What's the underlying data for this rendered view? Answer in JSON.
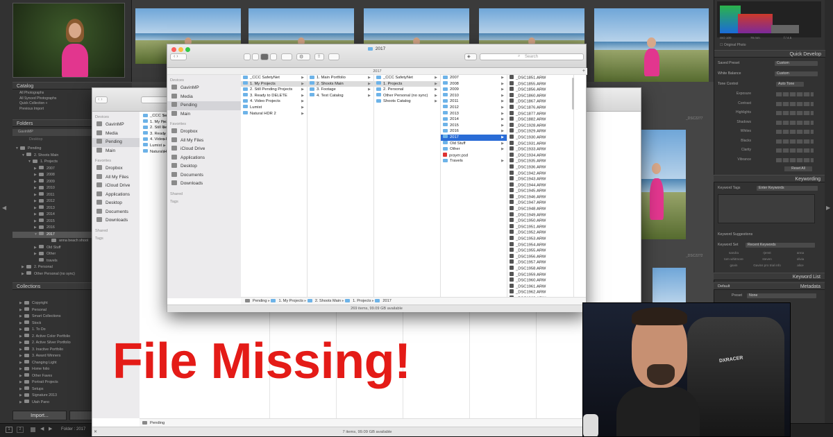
{
  "overlay_title": "File Missing!",
  "lightroom": {
    "catalog": {
      "header": "Catalog",
      "items": [
        "All Photographs",
        "All Synced Photographs",
        "Quick Collection +",
        "Previous Import"
      ]
    },
    "folders": {
      "header": "Folders",
      "volume": "GavinMP",
      "desktop": "Desktop",
      "rows": [
        {
          "label": "Pending",
          "indent": 0,
          "tri": "▼"
        },
        {
          "label": "2. Shoots Main",
          "indent": 1,
          "tri": "▼"
        },
        {
          "label": "1. Projects",
          "indent": 2,
          "tri": "▼"
        },
        {
          "label": "2007",
          "indent": 3,
          "tri": "▶"
        },
        {
          "label": "2008",
          "indent": 3,
          "tri": "▶"
        },
        {
          "label": "2009",
          "indent": 3,
          "tri": "▶"
        },
        {
          "label": "2010",
          "indent": 3,
          "tri": "▶"
        },
        {
          "label": "2011",
          "indent": 3,
          "tri": "▶"
        },
        {
          "label": "2012",
          "indent": 3,
          "tri": "▶"
        },
        {
          "label": "2013",
          "indent": 3,
          "tri": "▶"
        },
        {
          "label": "2014",
          "indent": 3,
          "tri": "▶"
        },
        {
          "label": "2015",
          "indent": 3,
          "tri": "▶"
        },
        {
          "label": "2016",
          "indent": 3,
          "tri": "▶"
        },
        {
          "label": "2017",
          "indent": 3,
          "tri": "▼",
          "selected": true
        },
        {
          "label": "anna beach shoot",
          "indent": 5,
          "tri": ""
        },
        {
          "label": "Old Stuff",
          "indent": 3,
          "tri": "▶"
        },
        {
          "label": "Other",
          "indent": 3,
          "tri": "▶"
        },
        {
          "label": "travels",
          "indent": 3,
          "tri": ""
        },
        {
          "label": "2. Personal",
          "indent": 1,
          "tri": "▶"
        },
        {
          "label": "Other Personal (no sync)",
          "indent": 1,
          "tri": "▶"
        }
      ]
    },
    "collections": {
      "header": "Collections",
      "items": [
        "Copyright",
        "Personal",
        "Smart Collections",
        "Stock",
        "1. To Do",
        "2. Active Color Portfolio",
        "2. Active Silver Portfolio",
        "3. Inactive Portfolio",
        "3. Award Winners",
        "Changing Light",
        "Home folio",
        "Other Faves",
        "Portrait Projects",
        "Setups",
        "Signature 2013",
        "Utah Pano"
      ]
    },
    "import_button": "Import...",
    "folder_status": "Folder : 2017",
    "page_numbers": [
      "1",
      "2"
    ],
    "filenames": [
      "_DSC2277",
      "_DSC2272"
    ],
    "histogram": {
      "iso": "ISO 100",
      "lens": "78 mm",
      "aperture": "f / 4.5",
      "original": "Original Photo"
    },
    "quick_develop": {
      "header": "Quick Develop",
      "saved_preset": "Saved Preset",
      "saved_preset_value": "Custom",
      "white_balance": "White Balance",
      "white_balance_value": "Custom",
      "tone_control": "Tone Control",
      "auto_tone": "Auto Tone",
      "sliders": [
        "Exposure",
        "Contrast",
        "Highlights",
        "Shadows",
        "Whites",
        "Blacks",
        "Clarity",
        "Vibrance"
      ],
      "reset": "Reset All"
    },
    "keywording": {
      "header": "Keywording",
      "tags_label": "Keyword Tags",
      "tags_value": "Enter Keywords",
      "suggestions": "Keyword Suggestions",
      "set_label": "Keyword Set",
      "set_value": "Recent Keywords",
      "words": [
        "sandra",
        "rjenst",
        "anna",
        "tom whitmore",
        "steven",
        "olivia",
        "gavin",
        "Gavins pro trial info",
        "alice"
      ]
    },
    "keyword_list": "Keyword List",
    "metadata": {
      "header": "Metadata",
      "default": "Default",
      "preset": "Preset",
      "preset_value": "None"
    }
  },
  "finder_front": {
    "title": "2017",
    "path_header": "2017",
    "search_placeholder": "Search",
    "sidebar": {
      "devices_header": "Devices",
      "devices": [
        "GavinMP",
        "Media",
        "Pending",
        "Main"
      ],
      "favorites_header": "Favorites",
      "favorites": [
        "Dropbox",
        "All My Files",
        "iCloud Drive",
        "Applications",
        "Desktop",
        "Documents",
        "Downloads"
      ],
      "shared_header": "Shared",
      "tags_header": "Tags"
    },
    "col1": [
      "_CCC SafetyNet",
      "1. My Projects",
      "2. Still Pending Projects",
      "3. Ready to DELETE",
      "4. Video Projects",
      "Lumist",
      "Natural HDR 2"
    ],
    "col2": [
      "1. Main Portfolio",
      "2. Shoots Main",
      "3. Footage",
      "4. Test Catalog"
    ],
    "col3": [
      "_CCC SafetyNet",
      "1. Projects",
      "2. Personal",
      "Other Personal (no sync)",
      "Shoots Catalog"
    ],
    "col4": [
      "2007",
      "2008",
      "2009",
      "2010",
      "2011",
      "2012",
      "2013",
      "2014",
      "2015",
      "2016",
      "2017",
      "Old Stuff",
      "Other",
      "prayer.psd",
      "Travels"
    ],
    "col5": [
      "_DSC1851.ARW",
      "_DSC1855.ARW",
      "_DSC1856.ARW",
      "_DSC1860.ARW",
      "_DSC1867.ARW",
      "_DSC1876.ARW",
      "_DSC1877.ARW",
      "_DSC1882.ARW",
      "_DSC1928.ARW",
      "_DSC1929.ARW",
      "_DSC1930.ARW",
      "_DSC1931.ARW",
      "_DSC1933.ARW",
      "_DSC1934.ARW",
      "_DSC1935.ARW",
      "_DSC1936.ARW",
      "_DSC1942.ARW",
      "_DSC1943.ARW",
      "_DSC1944.ARW",
      "_DSC1945.ARW",
      "_DSC1946.ARW",
      "_DSC1947.ARW",
      "_DSC1948.ARW",
      "_DSC1949.ARW",
      "_DSC1950.ARW",
      "_DSC1951.ARW",
      "_DSC1952.ARW",
      "_DSC1953.ARW",
      "_DSC1954.ARW",
      "_DSC1955.ARW",
      "_DSC1956.ARW",
      "_DSC1957.ARW",
      "_DSC1958.ARW",
      "_DSC1959.ARW",
      "_DSC1960.ARW",
      "_DSC1961.ARW",
      "_DSC1962.ARW",
      "_DSC1963.ARW"
    ],
    "breadcrumb": [
      "Pending",
      "1. My Projects",
      "2. Shoots Main",
      "1. Projects",
      "2017"
    ],
    "status": "269 items, 99.09 GB available"
  },
  "finder_back": {
    "sidebar": {
      "devices_header": "Devices",
      "devices": [
        "GavinMP",
        "Media",
        "Pending",
        "Main"
      ],
      "favorites_header": "Favorites",
      "favorites": [
        "Dropbox",
        "All My Files",
        "iCloud Drive",
        "Applications",
        "Desktop",
        "Documents",
        "Downloads"
      ],
      "shared_header": "Shared",
      "tags_header": "Tags"
    },
    "col1": [
      "_CCC Safe",
      "1. My Pro",
      "2. Still Pen",
      "3. Ready",
      "4. Video P",
      "Lumist",
      "Natural HI"
    ],
    "breadcrumb": "Pending",
    "status": "7 items, 99.09 GB available"
  },
  "brand": "DXRACER",
  "colors": {
    "title_red": "#e41b17",
    "finder_blue": "#2a6cd6",
    "folder_blue": "#6db3e8",
    "lr_bg": "#2b2b2b"
  }
}
